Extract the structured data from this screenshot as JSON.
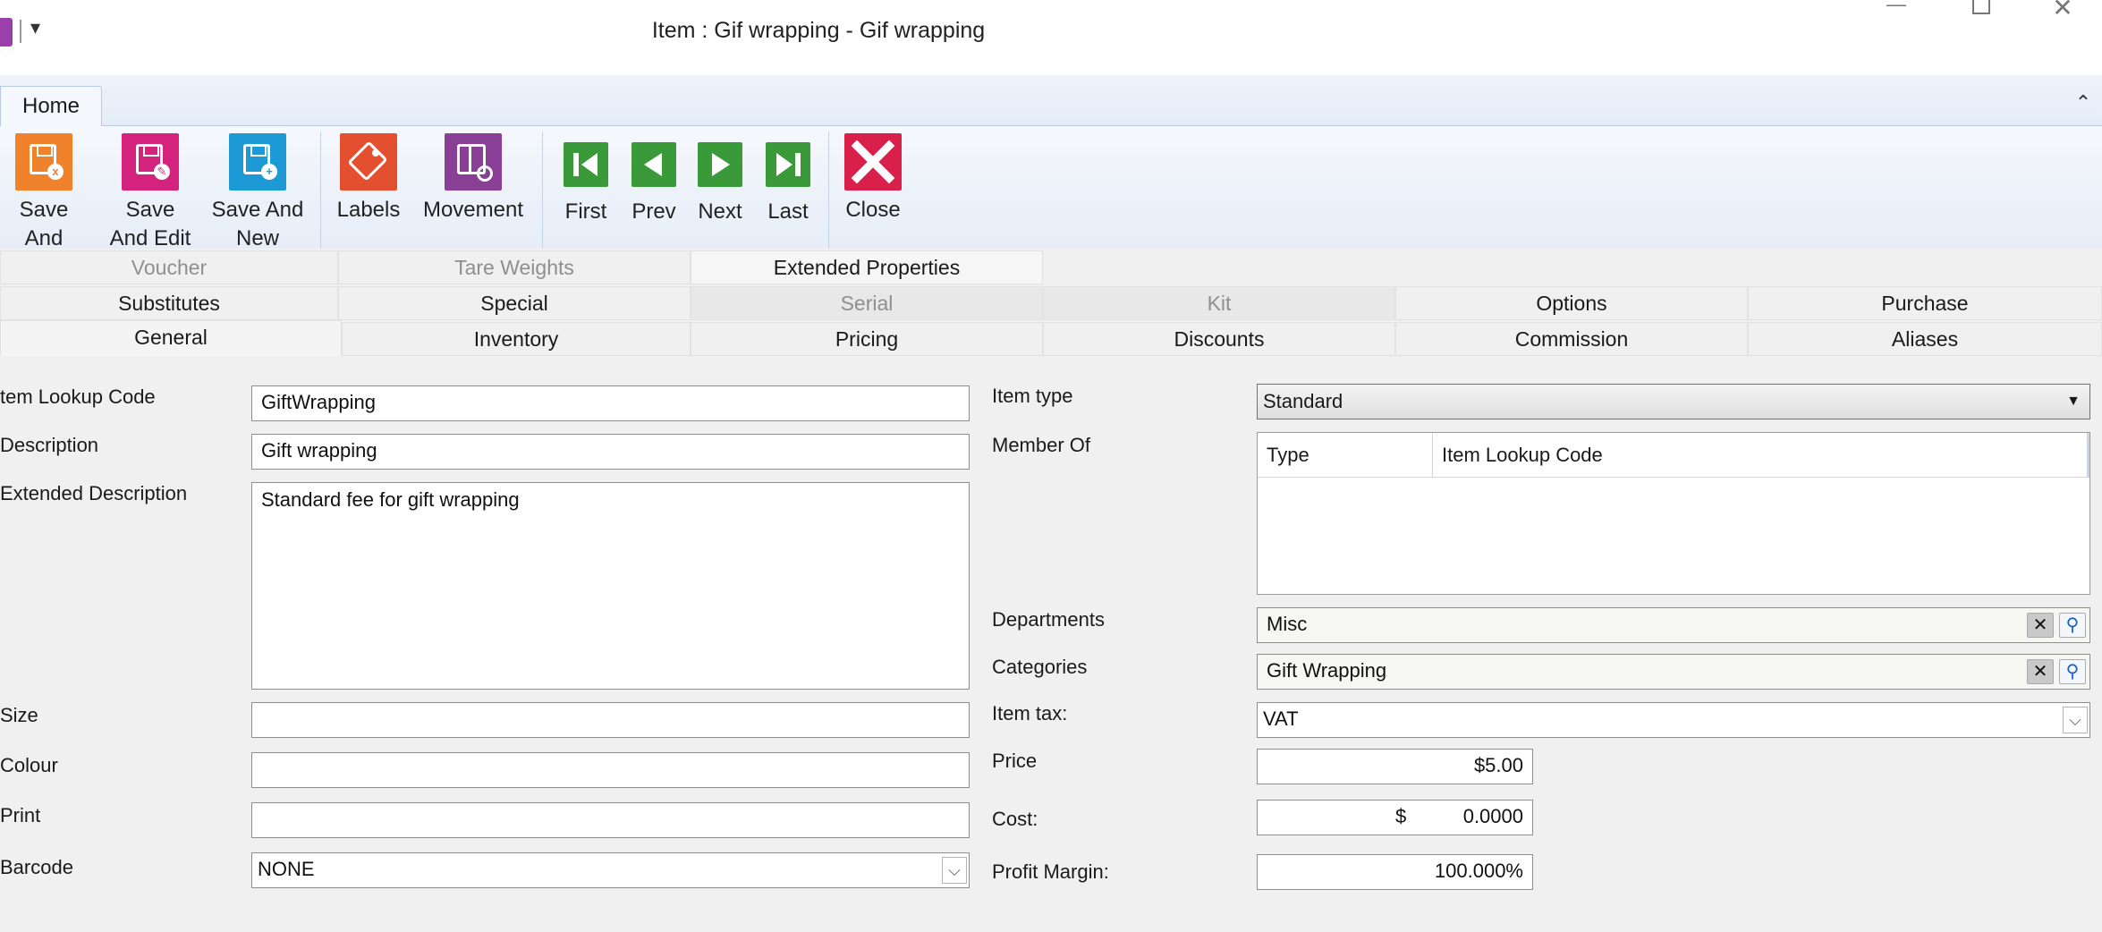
{
  "window": {
    "title": "Item : Gif wrapping - Gif wrapping",
    "qa_menu_glyph": "▾",
    "min_glyph": "—",
    "close_glyph": "✕"
  },
  "ribbon": {
    "tab": "Home",
    "collapse_glyph": "⌃",
    "buttons": [
      {
        "label": "Save And\nClose",
        "icon": "save-close-icon",
        "color": "#f0822c"
      },
      {
        "label": "Save\nAnd Edit",
        "icon": "save-edit-icon",
        "color": "#d4237c"
      },
      {
        "label": "Save And\nNew",
        "icon": "save-new-icon",
        "color": "#1d9ad6"
      },
      {
        "label": "Labels",
        "icon": "labels-icon",
        "color": "#e4502f"
      },
      {
        "label": "Movement",
        "icon": "movement-icon",
        "color": "#8a3f96"
      },
      {
        "label": "First",
        "icon": "first-icon",
        "color": "#3a9a3a"
      },
      {
        "label": "Prev",
        "icon": "prev-icon",
        "color": "#3a9a3a"
      },
      {
        "label": "Next",
        "icon": "next-icon",
        "color": "#3a9a3a"
      },
      {
        "label": "Last",
        "icon": "last-icon",
        "color": "#3a9a3a"
      },
      {
        "label": "Close",
        "icon": "close-icon",
        "color": "#d8204a"
      }
    ]
  },
  "tabs": {
    "row1": [
      "Voucher",
      "Tare Weights",
      "Extended Properties"
    ],
    "row2": [
      "Substitutes",
      "Special",
      "Serial",
      "Kit",
      "Options",
      "Purchase"
    ],
    "row3": [
      "General",
      "Inventory",
      "Pricing",
      "Discounts",
      "Commission",
      "Aliases"
    ]
  },
  "form": {
    "labels": {
      "item_lookup_code": "tem Lookup Code",
      "description": "Description",
      "extended_description": "Extended Description",
      "size": "Size",
      "colour": "Colour",
      "print": "Print",
      "barcode": "Barcode",
      "item_type": "Item type",
      "member_of": "Member Of",
      "departments": "Departments",
      "categories": "Categories",
      "item_tax": "Item tax:",
      "price": "Price",
      "cost": "Cost:",
      "profit_margin": "Profit Margin:"
    },
    "values": {
      "item_lookup_code": "GiftWrapping",
      "description": "Gift wrapping",
      "extended_description": "Standard fee for gift wrapping",
      "size": "",
      "colour": "",
      "print": "",
      "barcode": "NONE",
      "item_type": "Standard",
      "departments": "Misc",
      "categories": "Gift Wrapping",
      "item_tax": "VAT",
      "price": "$5.00",
      "cost_currency": "$",
      "cost": "0.0000",
      "profit_margin": "100.000%"
    },
    "member_of_columns": [
      "Type",
      "Item Lookup Code"
    ]
  }
}
